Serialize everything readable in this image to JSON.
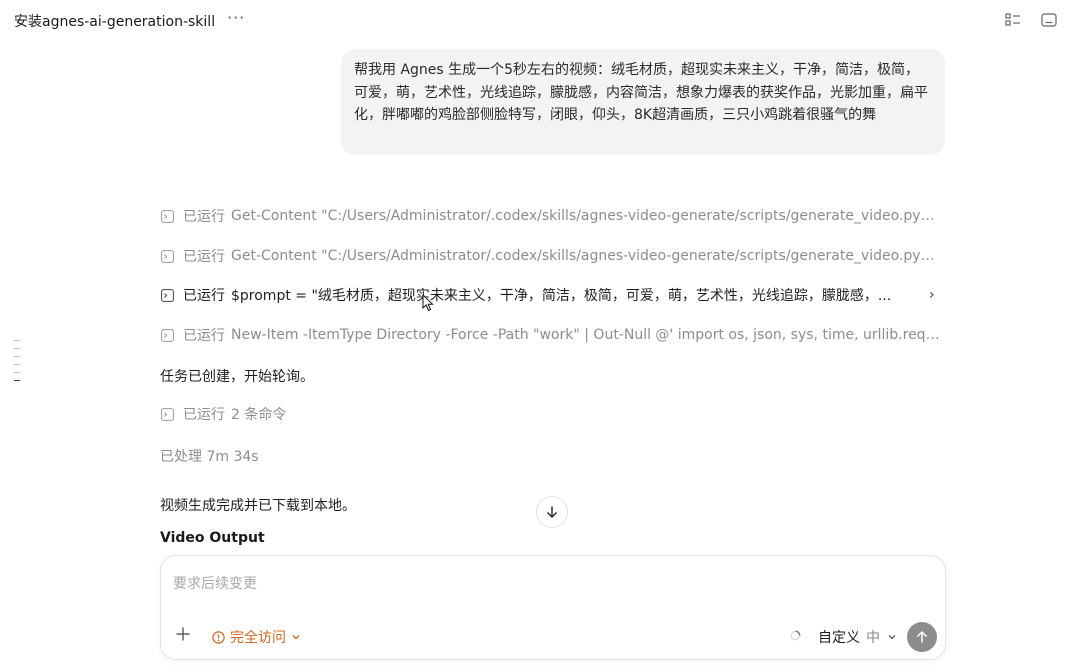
{
  "header": {
    "title": "安装agnes-ai-generation-skill",
    "more_label": "···",
    "icons": [
      "checklist-icon",
      "terminal-panel-icon"
    ]
  },
  "user_message": "帮我用 Agnes 生成一个5秒左右的视频：绒毛材质，超现实未来主义，干净，简洁，极简，可爱，萌，艺术性，光线追踪，朦胧感，内容简洁，想象力爆表的获奖作品，光影加重，扁平化，胖嘟嘟的鸡脸部侧脸特写，闭眼，仰头，8K超清画质，三只小鸡跳着很骚气的舞",
  "steps": [
    {
      "label": "已运行",
      "command": "Get-Content \"C:/Users/Administrator/.codex/skills/agnes-video-generate/scripts/generate_video.py\"; ...",
      "state": "muted"
    },
    {
      "label": "已运行",
      "command": "Get-Content \"C:/Users/Administrator/.codex/skills/agnes-video-generate/scripts/generate_video.py\" | ...",
      "state": "muted"
    },
    {
      "label": "已运行",
      "command": "$prompt = \"绒毛材质，超现实未来主义，干净，简洁，极简，可爱，萌，艺术性，光线追踪，朦胧感，...",
      "state": "active"
    },
    {
      "label": "已运行",
      "command": "New-Item -ItemType Directory -Force -Path \"work\" | Out-Null @' import os, json, sys, time, urllib.reques...",
      "state": "muted"
    }
  ],
  "status": {
    "task_created": "任务已创建，开始轮询。",
    "ran_commands_label": "已运行",
    "ran_commands_count": "2 条命令",
    "processed": "已处理 7m 34s",
    "done": "视频生成完成并已下载到本地。",
    "output_heading": "Video Output"
  },
  "composer": {
    "placeholder": "要求后续变更",
    "access_label": "完全访问",
    "model_label": "自定义",
    "level_label": "中"
  },
  "colors": {
    "accent_orange": "#d9641c",
    "muted_text": "#8c8c8c",
    "bubble_bg": "#f3f3f3",
    "send_button": "#8c8c8c"
  }
}
